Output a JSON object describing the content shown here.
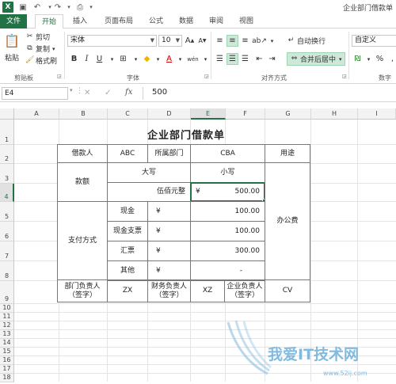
{
  "window": {
    "title": "企业部门借款单"
  },
  "tabs": [
    "文件",
    "开始",
    "插入",
    "页面布局",
    "公式",
    "数据",
    "审阅",
    "视图"
  ],
  "ribbon": {
    "clipboard": {
      "paste": "粘贴",
      "cut": "剪切",
      "copy": "复制",
      "format_painter": "格式刷",
      "label": "剪贴板"
    },
    "font": {
      "name": "宋体",
      "size": "10",
      "label": "字体",
      "bold": "B",
      "italic": "I",
      "underline": "U",
      "grow": "A",
      "shrink": "A",
      "wen": "wén"
    },
    "alignment": {
      "wrap": "自动换行",
      "merge": "合并后居中",
      "label": "对齐方式"
    },
    "number": {
      "format": "自定义",
      "label": "数字",
      "percent": "%"
    }
  },
  "formula_bar": {
    "name_box": "E4",
    "cancel": "✕",
    "enter": "✓",
    "fx": "fx",
    "value": "500"
  },
  "columns": [
    "A",
    "B",
    "C",
    "D",
    "E",
    "F",
    "G",
    "H",
    "I"
  ],
  "rows": [
    "1",
    "2",
    "3",
    "4",
    "5",
    "6",
    "7",
    "8",
    "9",
    "10",
    "11",
    "12",
    "13",
    "14",
    "15",
    "16",
    "17",
    "18"
  ],
  "sheet": {
    "title": "企业部门借款单",
    "borrower_label": "借款人",
    "borrower": "ABC",
    "dept_label": "所属部门",
    "dept": "CBA",
    "purpose_label": "用途",
    "amount_label": "款额",
    "upper_label": "大写",
    "lower_label": "小写",
    "upper_value": "伍佰元整",
    "currency": "¥",
    "lower_value": "500.00",
    "pay_label": "支付方式",
    "purpose": "办公费",
    "pay_rows": [
      {
        "label": "现金",
        "currency": "¥",
        "value": "100.00"
      },
      {
        "label": "现金支票",
        "currency": "¥",
        "value": "100.00"
      },
      {
        "label": "汇票",
        "currency": "¥",
        "value": "300.00"
      },
      {
        "label": "其他",
        "currency": "¥",
        "value": "-"
      }
    ],
    "dept_head": "部门负责人\n（签字）",
    "dept_head_val": "ZX",
    "fin_head": "财务负责人\n（签字）",
    "fin_head_val": "XZ",
    "corp_head": "企业负责人\n（签字）",
    "corp_head_val": "CV"
  },
  "colors": {
    "accent": "#217346",
    "selection": "#cde8d8"
  },
  "watermark": "我爱IT技术网 www.52ij.com"
}
